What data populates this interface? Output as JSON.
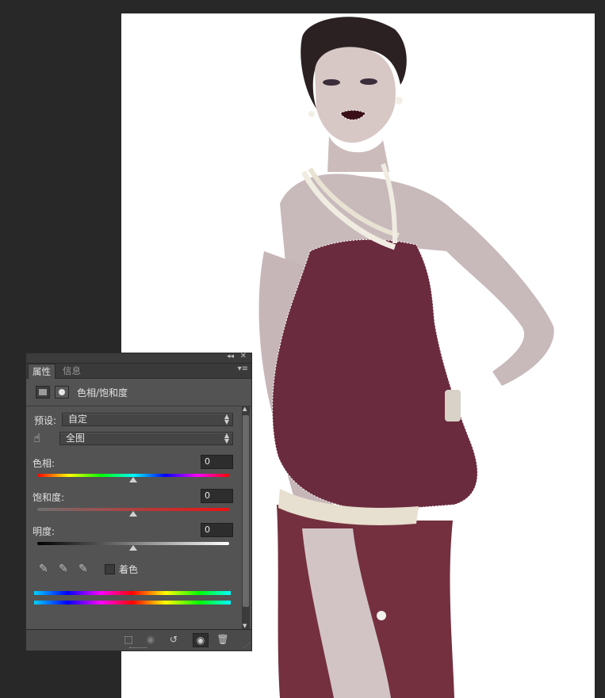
{
  "canvas": {
    "subject": "photo-woman-red-dress"
  },
  "panel": {
    "tabs": [
      "属性",
      "信息"
    ],
    "adjustment_title": "色相/饱和度",
    "preset_label": "预设:",
    "preset_value": "自定",
    "channel_value": "全图",
    "hue": {
      "label": "色相:",
      "value": "0",
      "level_fraction": 0.5
    },
    "saturation": {
      "label": "饱和度:",
      "value": "0",
      "level_fraction": 0.5
    },
    "lightness": {
      "label": "明度:",
      "value": "0",
      "level_fraction": 0.5
    },
    "colorize_label": "着色",
    "colorize_checked": false,
    "icons": {
      "adjustment": "hue-saturation-icon",
      "mask": "mask-icon",
      "target_adjust": "hand-target-icon",
      "eyedroppers": [
        "eyedropper-icon",
        "eyedropper-plus-icon",
        "eyedropper-minus-icon"
      ],
      "footer": [
        "clip-to-layer-icon",
        "view-previous-icon",
        "reset-icon",
        "visibility-eye-icon",
        "trash-icon"
      ]
    },
    "colors": {
      "panel_bg": "#535353",
      "dress": "#6d2a3e",
      "hue_gradient": [
        "#ff0000",
        "#ffff00",
        "#00ff00",
        "#00ffff",
        "#0000ff",
        "#ff00ff",
        "#ff0000"
      ],
      "saturation_gradient": [
        "#7a7a7a",
        "#ff0000"
      ],
      "lightness_gradient": [
        "#000000",
        "#ffffff"
      ]
    }
  }
}
